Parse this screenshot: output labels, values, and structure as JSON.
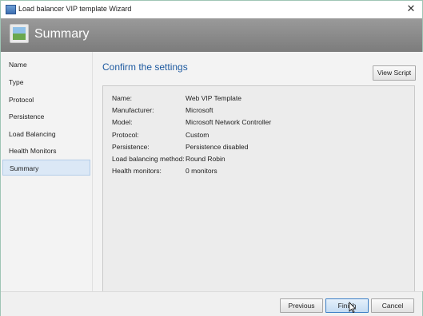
{
  "window": {
    "title": "Load balancer VIP template Wizard"
  },
  "header": {
    "title": "Summary",
    "icon": "wizard-picture-icon"
  },
  "sidebar": {
    "items": [
      {
        "label": "Name",
        "selected": false
      },
      {
        "label": "Type",
        "selected": false
      },
      {
        "label": "Protocol",
        "selected": false
      },
      {
        "label": "Persistence",
        "selected": false
      },
      {
        "label": "Load Balancing",
        "selected": false
      },
      {
        "label": "Health Monitors",
        "selected": false
      },
      {
        "label": "Summary",
        "selected": true
      }
    ]
  },
  "main": {
    "heading": "Confirm the settings",
    "view_script_label": "View Script",
    "settings": [
      {
        "key": "Name:",
        "value": "Web VIP Template"
      },
      {
        "key": "Manufacturer:",
        "value": "Microsoft"
      },
      {
        "key": "Model:",
        "value": "Microsoft Network Controller"
      },
      {
        "key": "Protocol:",
        "value": "Custom"
      },
      {
        "key": "Persistence:",
        "value": "Persistence disabled"
      },
      {
        "key": "Load balancing method:",
        "value": "Round Robin"
      },
      {
        "key": "Health monitors:",
        "value": "0 monitors"
      }
    ]
  },
  "footer": {
    "previous_label": "Previous",
    "finish_label": "Finish",
    "cancel_label": "Cancel"
  },
  "colors": {
    "header_bg": "#8a8a8a",
    "accent_text": "#1e5aa0",
    "selected_bg": "#dbe8f6"
  }
}
